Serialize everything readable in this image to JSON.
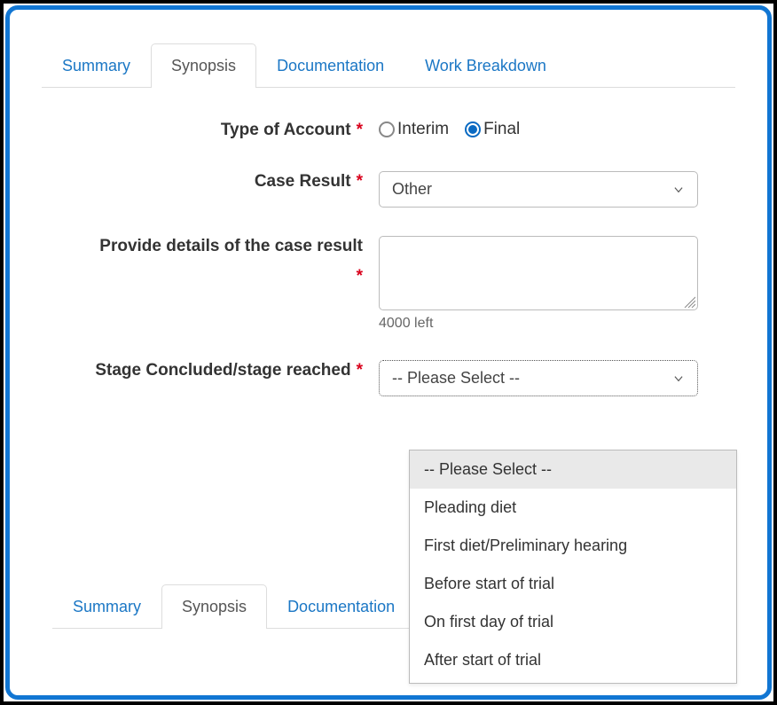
{
  "tabs": [
    {
      "label": "Summary"
    },
    {
      "label": "Synopsis"
    },
    {
      "label": "Documentation"
    },
    {
      "label": "Work Breakdown"
    }
  ],
  "form": {
    "type_of_account": {
      "label": "Type of Account",
      "options": [
        "Interim",
        "Final"
      ],
      "selected": "Final"
    },
    "case_result": {
      "label": "Case Result",
      "selected": "Other"
    },
    "details": {
      "label": "Provide details of the case result",
      "char_left": "4000 left"
    },
    "stage": {
      "label": "Stage Concluded/stage reached",
      "selected": "-- Please Select --"
    }
  },
  "dropdown": {
    "items": [
      "-- Please Select --",
      "Pleading diet",
      "First diet/Preliminary hearing",
      "Before start of trial",
      "On first day of trial",
      "After start of trial"
    ]
  },
  "tabs2": [
    {
      "label": "Summary"
    },
    {
      "label": "Synopsis"
    },
    {
      "label": "Documentation"
    }
  ]
}
